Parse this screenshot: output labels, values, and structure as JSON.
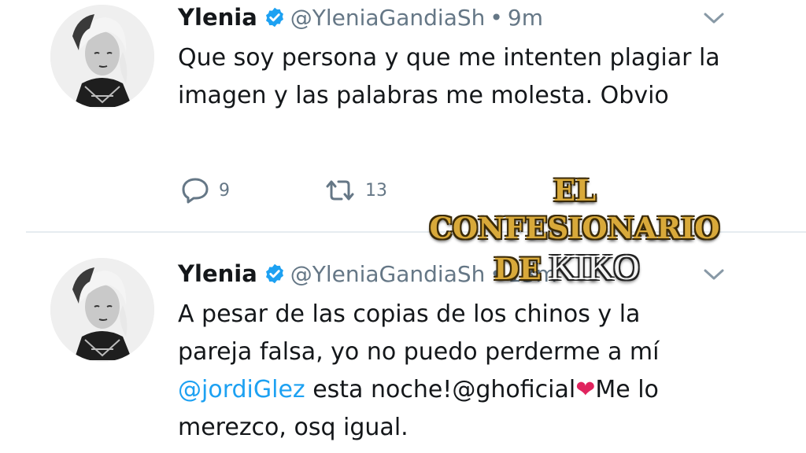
{
  "tweets": [
    {
      "name": "Ylenia",
      "handle": "@YleniaGandiaSh",
      "separator": "•",
      "time": "9m",
      "text": "Que soy persona y que me intenten plagiar la imagen y las palabras me molesta. Obvio",
      "replies": "9",
      "retweets": "13"
    },
    {
      "name": "Ylenia",
      "handle": "@YleniaGandiaSh",
      "separator": "•",
      "time": "13m",
      "text_before": "A pesar de las copias de los chinos y la pareja falsa, yo no puedo perderme a mí ",
      "mention_1": "@jordiGlez",
      "text_middle": " esta noche!@ghoficial",
      "heart": "❤",
      "text_after": "Me lo merezco, osq igual."
    }
  ],
  "watermark": {
    "line1": "EL CONFESIONARIO",
    "de": "DE",
    "kiko": "KIKO"
  },
  "colors": {
    "verified_badge": "#1da1f2",
    "mention": "#1da1f2",
    "secondary_text": "#657786",
    "heart": "#e0245e",
    "watermark_gold": "#d8a93a"
  },
  "icons": [
    "verified-badge-icon",
    "chevron-down-icon",
    "reply-icon",
    "retweet-icon"
  ]
}
